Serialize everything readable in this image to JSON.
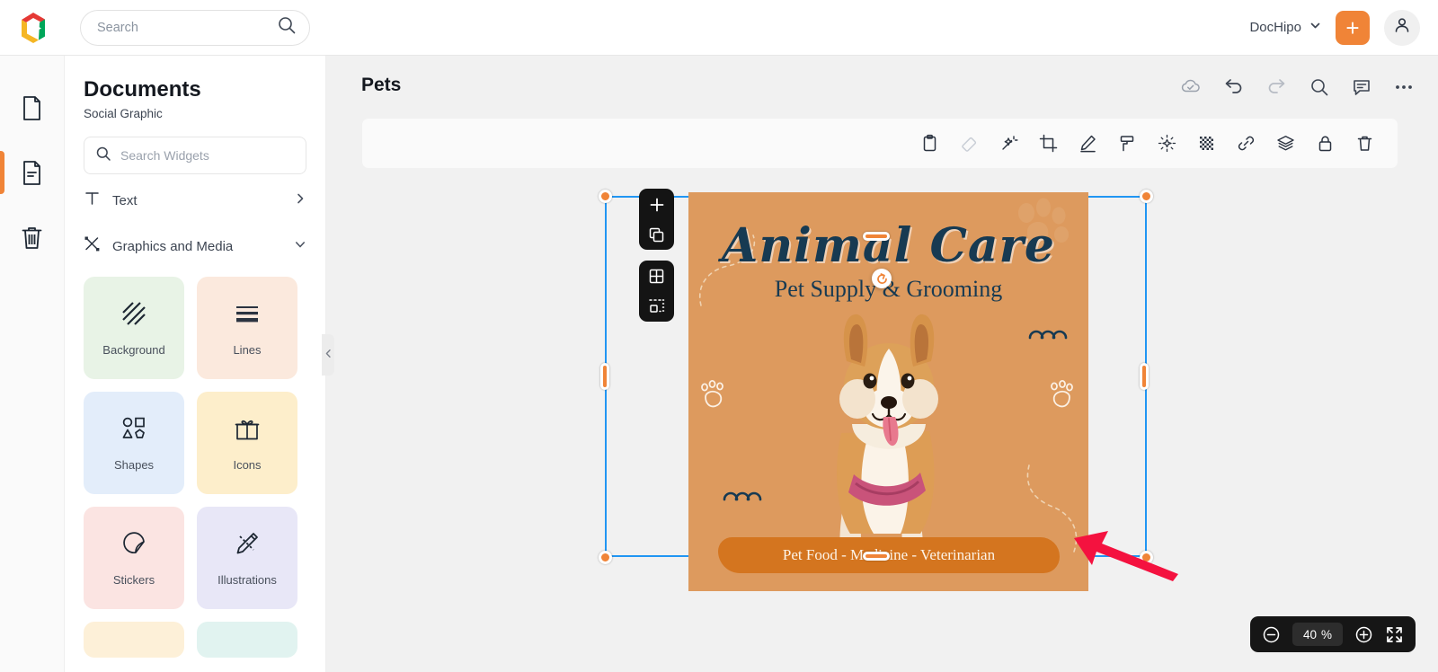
{
  "topbar": {
    "logo_icon": "dochipo-logo-icon",
    "search": {
      "value": "",
      "placeholder": "Search",
      "icon": "search-icon"
    },
    "brand": {
      "label": "DocHipo",
      "chevron_icon": "chevron-down-icon"
    },
    "create_button": {
      "label": "+",
      "icon": "plus-icon"
    },
    "account_button": {
      "icon": "user-avatar-icon"
    }
  },
  "rail": {
    "items": [
      {
        "name": "documents",
        "icon": "page-icon",
        "active": false
      },
      {
        "name": "my-designs",
        "icon": "document-lines-icon",
        "active": true
      },
      {
        "name": "trash",
        "icon": "trash-icon",
        "active": false
      }
    ]
  },
  "panel": {
    "title": "Documents",
    "subtitle": "Social Graphic",
    "search": {
      "value": "",
      "placeholder": "Search Widgets",
      "icon": "search-icon"
    },
    "categories": [
      {
        "label": "Text",
        "icon": "text-t-icon",
        "chevron": "chevron-right-icon",
        "expanded": false
      },
      {
        "label": "Graphics and Media",
        "icon": "graphics-media-icon",
        "chevron": "chevron-down-icon",
        "expanded": true
      }
    ],
    "widgets": [
      {
        "label": "Background",
        "icon": "diagonal-stripes-icon",
        "bg": "#e8f3e6"
      },
      {
        "label": "Lines",
        "icon": "lines-icon",
        "bg": "#fbe9dd"
      },
      {
        "label": "Shapes",
        "icon": "shapes-icon",
        "bg": "#e3edfa"
      },
      {
        "label": "Icons",
        "icon": "gift-box-icon",
        "bg": "#fdeecb"
      },
      {
        "label": "Stickers",
        "icon": "sticker-icon",
        "bg": "#fbe4e2"
      },
      {
        "label": "Illustrations",
        "icon": "pencil-ruler-icon",
        "bg": "#e8e7f7"
      }
    ],
    "partial_widgets": [
      {
        "bg": "#fdf0d8"
      },
      {
        "bg": "#e1f3f0"
      }
    ],
    "collapse_tab_icon": "chevron-left-icon"
  },
  "main": {
    "document_title": "Pets",
    "header_icons": [
      {
        "name": "cloud-saved-icon"
      },
      {
        "name": "undo-icon"
      },
      {
        "name": "redo-icon"
      },
      {
        "name": "search-icon"
      },
      {
        "name": "comment-icon"
      },
      {
        "name": "more-options-icon"
      }
    ],
    "context_toolbar_icons": [
      {
        "name": "clipboard-icon",
        "disabled": false
      },
      {
        "name": "eraser-icon",
        "disabled": true
      },
      {
        "name": "magic-wand-icon",
        "disabled": false
      },
      {
        "name": "crop-icon",
        "disabled": false
      },
      {
        "name": "pen-edit-icon",
        "disabled": false
      },
      {
        "name": "paint-roller-icon",
        "disabled": false
      },
      {
        "name": "brightness-icon",
        "disabled": false
      },
      {
        "name": "transparency-icon",
        "disabled": false
      },
      {
        "name": "link-icon",
        "disabled": false
      },
      {
        "name": "layers-icon",
        "disabled": false
      },
      {
        "name": "lock-icon",
        "disabled": false
      },
      {
        "name": "delete-icon",
        "disabled": false
      }
    ],
    "element_toolbars": [
      {
        "name": "add-element-toolbar",
        "icons": [
          "plus-icon",
          "duplicate-icon"
        ]
      },
      {
        "name": "grid-toolbar",
        "icons": [
          "grid-icon",
          "select-area-icon"
        ]
      }
    ],
    "selection": {
      "rotate_icon": "rotate-handle-icon",
      "handle_color": "#f08437",
      "outline_color": "#2196f3"
    },
    "annotation": {
      "name": "red-arrow-annotation",
      "color": "#f0123f"
    },
    "zoom": {
      "minus_icon": "zoom-out-icon",
      "value": "40",
      "unit": "%",
      "plus_icon": "zoom-in-icon",
      "fullscreen_icon": "fullscreen-icon"
    }
  },
  "design": {
    "title": "Animal Care",
    "subtitle": "Pet Supply & Grooming",
    "banner_text": "Pet Food - Medicine - Veterinarian",
    "background_color": "#dd9a5e",
    "accent_color": "#d4751f",
    "text_color": "#173a52",
    "decorations": [
      {
        "name": "paw-print-large",
        "position": "top-right"
      },
      {
        "name": "paw-print-outline-left",
        "position": "middle-left"
      },
      {
        "name": "paw-print-outline-right",
        "position": "middle-right"
      },
      {
        "name": "arc-decor-right",
        "position": "upper-right"
      },
      {
        "name": "arc-decor-left",
        "position": "lower-left"
      },
      {
        "name": "dashed-swirl-left",
        "position": "upper-left"
      },
      {
        "name": "dashed-swirl-right",
        "position": "lower-right"
      }
    ],
    "photo": {
      "name": "corgi-dog-photo"
    }
  }
}
